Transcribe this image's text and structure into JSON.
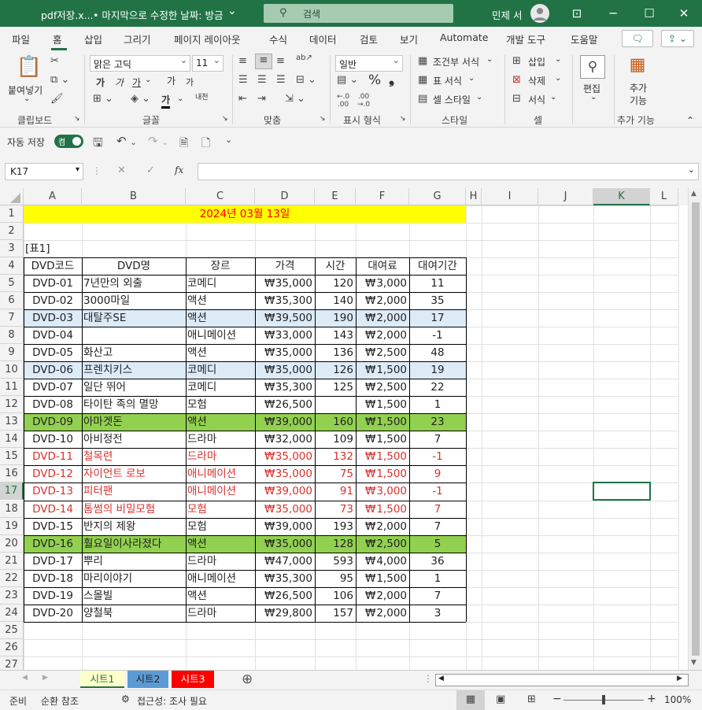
{
  "titlebar": {
    "filename": "pdf저장.x...",
    "saved_state": "• 마지막으로 수정한 날짜: 방금",
    "search_placeholder": "검색",
    "user": "민제 서"
  },
  "menu": {
    "tabs": [
      "파일",
      "홈",
      "삽입",
      "그리기",
      "페이지 레이아웃",
      "수식",
      "데이터",
      "검토",
      "보기",
      "Automate",
      "개발 도구",
      "도움말"
    ],
    "active": "홈"
  },
  "ribbon": {
    "clipboard": {
      "paste": "붙여넣기",
      "label": "클립보드"
    },
    "font": {
      "name": "맑은 고딕",
      "size": "11",
      "bold": "가",
      "italic": "가",
      "underline": "가",
      "grow": "가",
      "shrink": "가",
      "color": "가",
      "phonetic": "내천",
      "label": "글꼴"
    },
    "align": {
      "label": "맞춤"
    },
    "number": {
      "format": "일반",
      "percent": "%",
      "comma": "❟",
      "label": "표시 형식"
    },
    "styles": {
      "conditional": "조건부 서식",
      "table": "표 서식",
      "cell": "셀 스타일",
      "label": "스타일"
    },
    "cells": {
      "insert": "삽입",
      "delete": "삭제",
      "format": "서식",
      "label": "셀"
    },
    "editing": {
      "label": "편집"
    },
    "addins": {
      "label": "추가 기능",
      "button": "추가 기능"
    }
  },
  "qat": {
    "autosave": "자동 저장",
    "toggle": "켬"
  },
  "formula": {
    "namebox": "K17",
    "fx": "fx",
    "value": ""
  },
  "columns": [
    "A",
    "B",
    "C",
    "D",
    "E",
    "F",
    "G",
    "H",
    "I",
    "J",
    "K",
    "L"
  ],
  "selected_col": "K",
  "rows": [
    "1",
    "2",
    "3",
    "4",
    "5",
    "6",
    "7",
    "8",
    "9",
    "10",
    "11",
    "12",
    "13",
    "14",
    "15",
    "16",
    "17",
    "18",
    "19",
    "20",
    "21",
    "22",
    "23",
    "24",
    "25",
    "26",
    "27"
  ],
  "selected_row": "17",
  "sheet": {
    "date_title": "2024년 03월 13일",
    "table_label": "[표1]",
    "headers": [
      "DVD코드",
      "DVD명",
      "장르",
      "가격",
      "시간",
      "대여료",
      "대여기간"
    ],
    "currency": "₩",
    "data": [
      [
        "DVD-01",
        "7년만의 외출",
        "코메디",
        "35,000",
        "120",
        "3,000",
        "11"
      ],
      [
        "DVD-02",
        "3000마일",
        "액션",
        "35,300",
        "140",
        "2,000",
        "35"
      ],
      [
        "DVD-03",
        "대탈주SE",
        "액션",
        "39,500",
        "190",
        "2,000",
        "17"
      ],
      [
        "DVD-04",
        "",
        "애니메이션",
        "33,000",
        "143",
        "2,000",
        "-1"
      ],
      [
        "DVD-05",
        "화산고",
        "액션",
        "35,000",
        "136",
        "2,500",
        "48"
      ],
      [
        "DVD-06",
        "프렌치키스",
        "코메디",
        "35,000",
        "126",
        "1,500",
        "19"
      ],
      [
        "DVD-07",
        "일단 뛰어",
        "코메디",
        "35,300",
        "125",
        "2,500",
        "22"
      ],
      [
        "DVD-08",
        "타이탄 족의 멸망",
        "모험",
        "26,500",
        "",
        "1,500",
        "1"
      ],
      [
        "DVD-09",
        "아마겟돈",
        "액션",
        "39,000",
        "160",
        "1,500",
        "23"
      ],
      [
        "DVD-10",
        "아비정전",
        "드라마",
        "32,000",
        "109",
        "1,500",
        "7"
      ],
      [
        "DVD-11",
        "철목련",
        "드라마",
        "35,000",
        "132",
        "1,500",
        "-1"
      ],
      [
        "DVD-12",
        "자이언트 로보",
        "애니메이션",
        "35,000",
        "75",
        "1,500",
        "9"
      ],
      [
        "DVD-13",
        "피터팬",
        "애니메이션",
        "39,000",
        "91",
        "3,000",
        "-1"
      ],
      [
        "DVD-14",
        "톰썸의 비밀모험",
        "모험",
        "35,000",
        "73",
        "1,500",
        "7"
      ],
      [
        "DVD-15",
        "반지의 제왕",
        "모험",
        "39,000",
        "193",
        "2,000",
        "7"
      ],
      [
        "DVD-16",
        "훨요일이사라졌다",
        "액션",
        "35,000",
        "128",
        "2,500",
        "5"
      ],
      [
        "DVD-17",
        "뿌리",
        "드라마",
        "47,000",
        "593",
        "4,000",
        "36"
      ],
      [
        "DVD-18",
        "마리이야기",
        "애니메이션",
        "35,300",
        "95",
        "1,500",
        "1"
      ],
      [
        "DVD-19",
        "스몰빌",
        "액션",
        "26,500",
        "106",
        "2,000",
        "7"
      ],
      [
        "DVD-20",
        "양철북",
        "드라마",
        "29,800",
        "157",
        "2,000",
        "3"
      ]
    ],
    "row_styles": [
      "",
      "",
      "blue",
      "",
      "",
      "blue",
      "",
      "",
      "green",
      "",
      "red",
      "red",
      "red",
      "red",
      "",
      "green",
      "",
      "",
      "",
      ""
    ]
  },
  "colors": {
    "excel_green": "#217346",
    "title_fill": "#ffff00",
    "title_text": "#ff0000",
    "blue_fill": "#ddebf7",
    "green_fill": "#92d050",
    "red_text": "#d9302c"
  },
  "sheets": [
    {
      "name": "시트1",
      "color": "#ffffcc",
      "active": true
    },
    {
      "name": "시트2",
      "color": "#5b9bd5",
      "active": false
    },
    {
      "name": "시트3",
      "color": "#ff0000",
      "active": false
    }
  ],
  "status": {
    "ready": "준비",
    "circular": "순환 참조",
    "accessibility": "접근성: 조사 필요",
    "zoom": "100%"
  }
}
